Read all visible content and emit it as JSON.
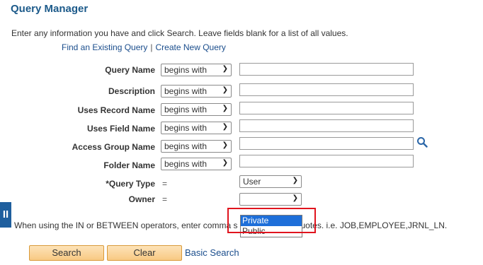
{
  "page": {
    "title": "Query Manager",
    "intro": "Enter any information you have and click Search. Leave fields blank for a list of all values.",
    "link_find": "Find an Existing Query",
    "link_sep": "|",
    "link_create": "Create New Query"
  },
  "fields": [
    {
      "label": "Query Name",
      "operator": "begins with"
    },
    {
      "label": "Description",
      "operator": "begins with"
    },
    {
      "label": "Uses Record Name",
      "operator": "begins with"
    },
    {
      "label": "Uses Field Name",
      "operator": "begins with"
    },
    {
      "label": "Access Group Name",
      "operator": "begins with"
    },
    {
      "label": "Folder Name",
      "operator": "begins with"
    }
  ],
  "query_type": {
    "label": "*Query Type",
    "operator": "=",
    "value": "User"
  },
  "owner": {
    "label": "Owner",
    "operator": "=",
    "value": "",
    "options": [
      "Private",
      "Public"
    ],
    "highlighted": "Private"
  },
  "note_prefix": "When using the IN or BETWEEN operators, enter comma s",
  "note_suffix": "without quotes. i.e. JOB,EMPLOYEE,JRNL_LN.",
  "buttons": {
    "search": "Search",
    "clear": "Clear",
    "basic_search": "Basic Search"
  },
  "side_tab": "II",
  "colors": {
    "title": "#1c5a8a",
    "link": "#1a4d8c",
    "highlight": "#1e6fd9",
    "annotation_box": "#e0141e",
    "button_border": "#d99a3a"
  }
}
